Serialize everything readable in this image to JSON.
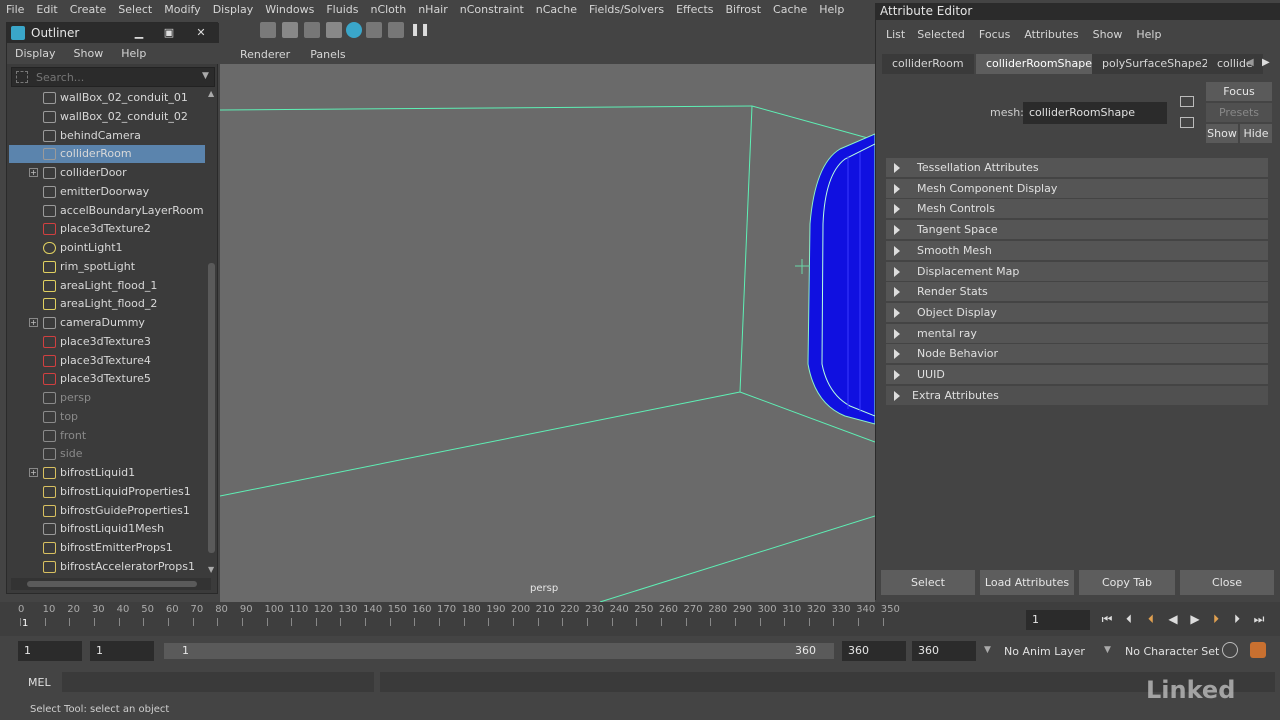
{
  "main_menu": [
    "File",
    "Edit",
    "Create",
    "Select",
    "Modify",
    "Display",
    "Windows",
    "Fluids",
    "nCloth",
    "nHair",
    "nConstraint",
    "nCache",
    "Fields/Solvers",
    "Effects",
    "Bifrost",
    "Cache",
    "Help"
  ],
  "viewport": {
    "menu": [
      "Renderer",
      "Panels"
    ],
    "camera_label": "persp"
  },
  "outliner": {
    "title": "Outliner",
    "menu": [
      "Display",
      "Show",
      "Help"
    ],
    "search_placeholder": "Search...",
    "items": [
      {
        "label": "wallBox_02_conduit_01",
        "icon": "mesh-icon"
      },
      {
        "label": "wallBox_02_conduit_02",
        "icon": "mesh-icon"
      },
      {
        "label": "behindCamera",
        "icon": "mesh-icon"
      },
      {
        "label": "colliderRoom",
        "icon": "mesh-icon",
        "selected": true
      },
      {
        "label": "colliderDoor",
        "icon": "mesh-icon",
        "expandable": true
      },
      {
        "label": "emitterDoorway",
        "icon": "mesh-icon"
      },
      {
        "label": "accelBoundaryLayerRoom",
        "icon": "mesh-icon"
      },
      {
        "label": "place3dTexture2",
        "icon": "texture-icon"
      },
      {
        "label": "pointLight1",
        "icon": "point-light-icon"
      },
      {
        "label": "rim_spotLight",
        "icon": "spot-light-icon"
      },
      {
        "label": "areaLight_flood_1",
        "icon": "area-light-icon"
      },
      {
        "label": "areaLight_flood_2",
        "icon": "area-light-icon"
      },
      {
        "label": "cameraDummy",
        "icon": "mesh-icon",
        "expandable": true
      },
      {
        "label": "place3dTexture3",
        "icon": "texture-icon"
      },
      {
        "label": "place3dTexture4",
        "icon": "texture-icon"
      },
      {
        "label": "place3dTexture5",
        "icon": "texture-icon"
      },
      {
        "label": "persp",
        "icon": "camera-icon",
        "dim": true
      },
      {
        "label": "top",
        "icon": "camera-icon",
        "dim": true
      },
      {
        "label": "front",
        "icon": "camera-icon",
        "dim": true
      },
      {
        "label": "side",
        "icon": "camera-icon",
        "dim": true
      },
      {
        "label": "bifrostLiquid1",
        "icon": "bifrost-icon",
        "expandable": true
      },
      {
        "label": "bifrostLiquidProperties1",
        "icon": "bifrost-icon"
      },
      {
        "label": "bifrostGuideProperties1",
        "icon": "bifrost-icon"
      },
      {
        "label": "bifrostLiquid1Mesh",
        "icon": "mesh-icon"
      },
      {
        "label": "bifrostEmitterProps1",
        "icon": "bifrost-icon"
      },
      {
        "label": "bifrostAcceleratorProps1",
        "icon": "bifrost-icon"
      }
    ]
  },
  "attribute_editor": {
    "title": "Attribute Editor",
    "menu": [
      "List",
      "Selected",
      "Focus",
      "Attributes",
      "Show",
      "Help"
    ],
    "tabs": [
      "colliderRoom",
      "colliderRoomShape",
      "polySurfaceShape2",
      "collide"
    ],
    "active_tab": "colliderRoomShape",
    "mesh_label": "mesh:",
    "mesh_value": "colliderRoomShape",
    "focus_button": "Focus",
    "presets_button": "Presets",
    "show_button": "Show",
    "hide_button": "Hide",
    "sections": [
      "Tessellation Attributes",
      "Mesh Component Display",
      "Mesh Controls",
      "Tangent Space",
      "Smooth Mesh",
      "Displacement Map",
      "Render Stats",
      "Object Display",
      "mental ray",
      "Node Behavior",
      "UUID",
      "Extra Attributes"
    ],
    "bottom_buttons": [
      "Select",
      "Load Attributes",
      "Copy Tab",
      "Close"
    ]
  },
  "timeline": {
    "ticks": [
      "0",
      "10",
      "20",
      "30",
      "40",
      "50",
      "60",
      "70",
      "80",
      "90",
      "100",
      "110",
      "120",
      "130",
      "140",
      "150",
      "160",
      "170",
      "180",
      "190",
      "200",
      "210",
      "220",
      "230",
      "240",
      "250",
      "260",
      "270",
      "280",
      "290",
      "300",
      "310",
      "320",
      "330",
      "340",
      "350"
    ],
    "current_frame_marker": "1",
    "current_frame": "1"
  },
  "range": {
    "start": "1",
    "playback_start": "1",
    "slider_start": "1",
    "slider_end": "360",
    "playback_end": "360",
    "end": "360",
    "anim_layer": "No Anim Layer",
    "character_set": "No Character Set"
  },
  "command_line": {
    "label": "MEL",
    "status": "Select Tool: select an object"
  },
  "watermark": "Linked"
}
